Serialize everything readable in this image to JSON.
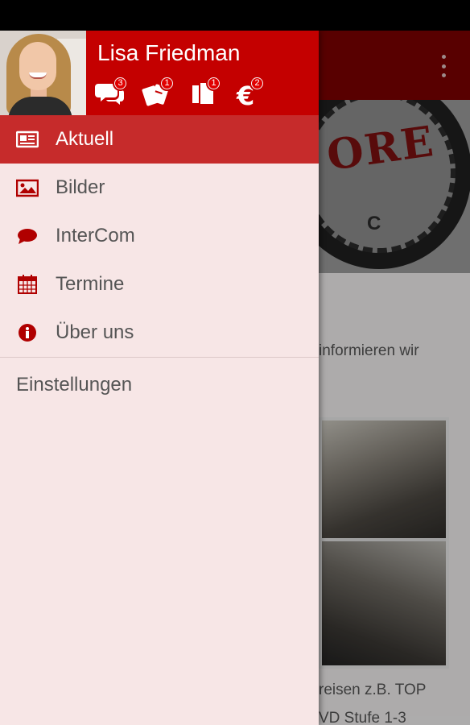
{
  "user": {
    "name": "Lisa Friedman"
  },
  "header_badges": [
    {
      "icon": "chat-icon",
      "count": "3"
    },
    {
      "icon": "tickets-icon",
      "count": "1"
    },
    {
      "icon": "documents-icon",
      "count": "1"
    },
    {
      "icon": "euro-icon",
      "count": "2"
    }
  ],
  "menu": {
    "items": [
      {
        "label": "Aktuell",
        "icon": "newspaper-icon",
        "active": true
      },
      {
        "label": "Bilder",
        "icon": "image-icon",
        "active": false
      },
      {
        "label": "InterCom",
        "icon": "chat-bubble-icon",
        "active": false
      },
      {
        "label": "Termine",
        "icon": "calendar-icon",
        "active": false
      },
      {
        "label": "Über uns",
        "icon": "info-icon",
        "active": false
      }
    ],
    "settings_label": "Einstellungen"
  },
  "background": {
    "banner_word": "ORE",
    "banner_letters": "C",
    "text_1": "informieren wir",
    "text_2": "reisen z.B. TOP",
    "text_3": "VD Stufe 1-3"
  },
  "colors": {
    "accent": "#c40000",
    "active_item": "#c62b2b",
    "drawer_bg": "#f7e6e6"
  }
}
